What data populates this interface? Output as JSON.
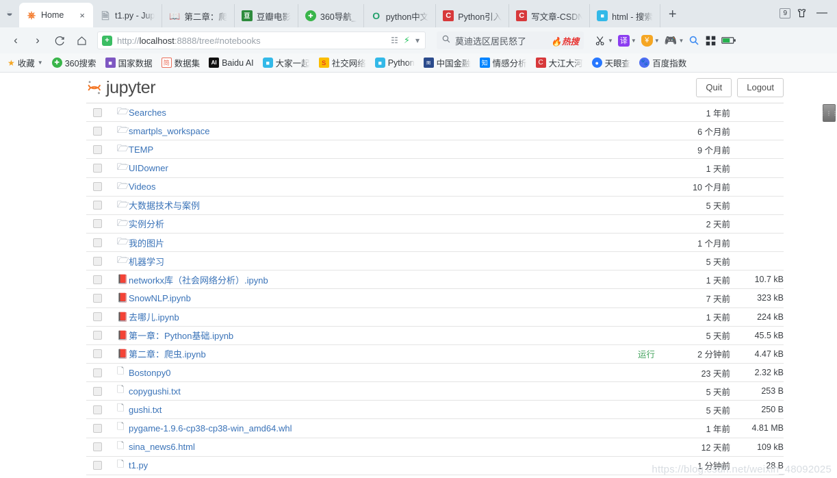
{
  "browser": {
    "tabs": [
      {
        "title": "Home",
        "icon": "jupyter-icon",
        "active": true,
        "close": "×"
      },
      {
        "title": "t1.py - Jup",
        "icon": "file-icon",
        "active": false
      },
      {
        "title": "第二章：爬",
        "icon": "notebook-icon",
        "active": false
      },
      {
        "title": "豆瓣电影",
        "icon": "douban-icon",
        "active": false
      },
      {
        "title": "360导航_",
        "icon": "360-icon",
        "active": false
      },
      {
        "title": "python中文",
        "icon": "opera-icon",
        "active": false
      },
      {
        "title": "Python引入",
        "icon": "csdn-icon",
        "active": false
      },
      {
        "title": "写文章-CSDN",
        "icon": "csdn-icon",
        "active": false
      },
      {
        "title": "html - 搜索",
        "icon": "bilibili-icon",
        "active": false
      }
    ],
    "new_tab_label": "+",
    "tab_count": "9",
    "skin_icon": "tshirt-icon",
    "minimize_label": "—",
    "nav": {
      "back": "‹",
      "forward": "›",
      "reload": "↻",
      "home": "⌂"
    },
    "omnibox": {
      "shield_icon": "shield-icon",
      "url_prefix": "http://",
      "url_host": "localhost",
      "url_suffix": ":8888/tree#notebooks",
      "full_url": "http://localhost:8888/tree#notebooks",
      "apps_icon": "apps-icon",
      "bolt_icon": "bolt-icon",
      "chevron_icon": "chevron-down-icon"
    },
    "search": {
      "icon": "search-icon",
      "value": "莫迪选区居民怒了",
      "hot_label": "热搜",
      "flame_icon": "flame-icon"
    },
    "toolbar_icons": [
      {
        "name": "scissors-icon",
        "glyph": "✂",
        "has_caret": true
      },
      {
        "name": "translate-icon",
        "glyph": "译",
        "has_caret": true
      },
      {
        "name": "coupon-icon",
        "glyph": "¥",
        "has_caret": true
      },
      {
        "name": "game-icon",
        "glyph": "⚙",
        "has_caret": true
      },
      {
        "name": "magnifier-icon",
        "glyph": "⚲",
        "has_caret": false
      },
      {
        "name": "grid-icon",
        "glyph": "░",
        "has_caret": false
      },
      {
        "name": "battery-icon",
        "glyph": "▬",
        "has_caret": false
      }
    ],
    "bookmarks": [
      {
        "label": "收藏",
        "icon": "star-icon",
        "caret": true
      },
      {
        "label": "360搜索",
        "icon": "360-icon"
      },
      {
        "label": "国家数据",
        "icon": "cube-icon"
      },
      {
        "label": "数据集",
        "icon": "jianshu-icon"
      },
      {
        "label": "Baidu AI",
        "icon": "ai-icon"
      },
      {
        "label": "大家一起",
        "icon": "bilibili-icon"
      },
      {
        "label": "社交网络",
        "icon": "sogou-icon"
      },
      {
        "label": "Python",
        "icon": "bilibili-icon"
      },
      {
        "label": "中国金融",
        "icon": "finance-icon"
      },
      {
        "label": "情感分析",
        "icon": "zhihu-icon"
      },
      {
        "label": "大江大河",
        "icon": "csdn-icon"
      },
      {
        "label": "天眼查",
        "icon": "tianyancha-icon"
      },
      {
        "label": "百度指数",
        "icon": "baidu-icon"
      }
    ]
  },
  "jupyter": {
    "logo_text": "jupyter",
    "logo_icon": "jupyter-logo-icon",
    "quit_label": "Quit",
    "logout_label": "Logout",
    "files": [
      {
        "name": "Searches",
        "type": "folder",
        "date": "1 年前",
        "size": "",
        "running": false
      },
      {
        "name": "smartpls_workspace",
        "type": "folder",
        "date": "6 个月前",
        "size": "",
        "running": false
      },
      {
        "name": "TEMP",
        "type": "folder",
        "date": "9 个月前",
        "size": "",
        "running": false
      },
      {
        "name": "UIDowner",
        "type": "folder",
        "date": "1 天前",
        "size": "",
        "running": false
      },
      {
        "name": "Videos",
        "type": "folder",
        "date": "10 个月前",
        "size": "",
        "running": false
      },
      {
        "name": "大数据技术与案例",
        "type": "folder",
        "date": "5 天前",
        "size": "",
        "running": false
      },
      {
        "name": "实例分析",
        "type": "folder",
        "date": "2 天前",
        "size": "",
        "running": false
      },
      {
        "name": "我的图片",
        "type": "folder",
        "date": "1 个月前",
        "size": "",
        "running": false
      },
      {
        "name": "机器学习",
        "type": "folder",
        "date": "5 天前",
        "size": "",
        "running": false
      },
      {
        "name": "networkx库（社会网络分析）.ipynb",
        "type": "notebook",
        "date": "1 天前",
        "size": "10.7 kB",
        "running": false
      },
      {
        "name": "SnowNLP.ipynb",
        "type": "notebook",
        "date": "7 天前",
        "size": "323 kB",
        "running": false
      },
      {
        "name": "去哪儿.ipynb",
        "type": "notebook",
        "date": "1 天前",
        "size": "224 kB",
        "running": false
      },
      {
        "name": "第一章：Python基础.ipynb",
        "type": "notebook",
        "date": "5 天前",
        "size": "45.5 kB",
        "running": false
      },
      {
        "name": "第二章：爬虫.ipynb",
        "type": "notebook",
        "date": "2 分钟前",
        "size": "4.47 kB",
        "running": true,
        "run_label": "运行"
      },
      {
        "name": "Bostonpy0",
        "type": "file",
        "date": "23 天前",
        "size": "2.32 kB",
        "running": false
      },
      {
        "name": "copygushi.txt",
        "type": "file",
        "date": "5 天前",
        "size": "253 B",
        "running": false
      },
      {
        "name": "gushi.txt",
        "type": "file",
        "date": "5 天前",
        "size": "250 B",
        "running": false
      },
      {
        "name": "pygame-1.9.6-cp38-cp38-win_amd64.whl",
        "type": "file",
        "date": "1 年前",
        "size": "4.81 MB",
        "running": false
      },
      {
        "name": "sina_news6.html",
        "type": "file",
        "date": "12 天前",
        "size": "109 kB",
        "running": false
      },
      {
        "name": "t1.py",
        "type": "file",
        "date": "1 分钟前",
        "size": "28 B",
        "running": false
      }
    ]
  },
  "watermark": "https://blog.csdn.net/weixin_48092025",
  "colors": {
    "jupyter_orange": "#f37726",
    "link_blue": "#3a73b8",
    "running_green": "#41a25b",
    "hot_red": "#e8312f"
  }
}
